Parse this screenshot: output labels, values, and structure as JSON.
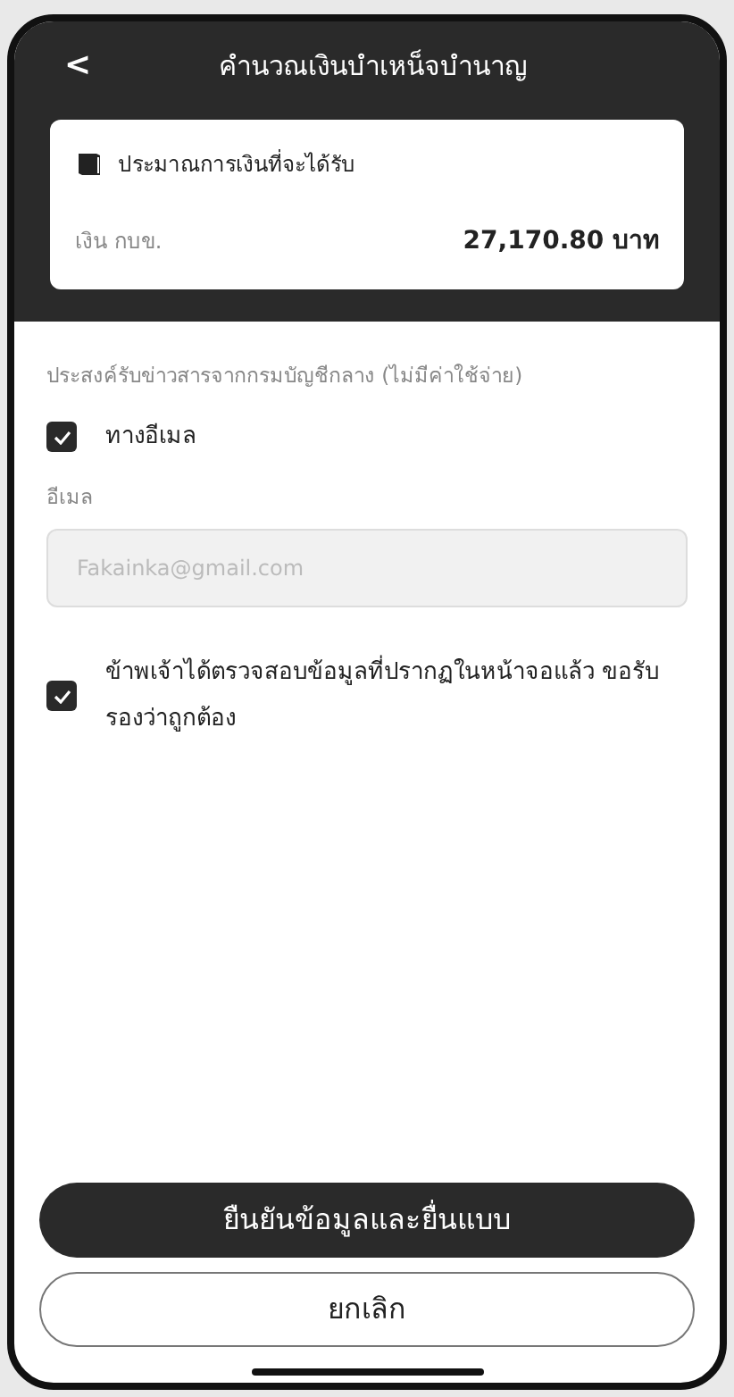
{
  "header": {
    "back": "<",
    "title": "คำนวณเงินบำเหน็จบำนาญ"
  },
  "estimate": {
    "title": "ประมาณการเงินที่จะได้รับ",
    "label": "เงิน กบข.",
    "value": "27,170.80 บาท"
  },
  "news": {
    "heading": "ประสงค์รับข่าวสารจากกรมบัญชีกลาง (ไม่มีค่าใช้จ่าย)",
    "option": {
      "label": "ทางอีเมล",
      "checked": true
    },
    "email_label": "อีเมล",
    "email": {
      "value": "Fakainka@gmail.com",
      "disabled": true
    }
  },
  "consent": {
    "label": "ข้าพเจ้าได้ตรวจสอบข้อมูลที่ปรากฏในหน้าจอแล้ว ขอรับรองว่าถูกต้อง",
    "checked": true
  },
  "buttons": [
    {
      "label": "ยืนยันข้อมูลและยื่นแบบ",
      "kind": "primary"
    },
    {
      "label": "ยกเลิก",
      "kind": "outline"
    }
  ]
}
